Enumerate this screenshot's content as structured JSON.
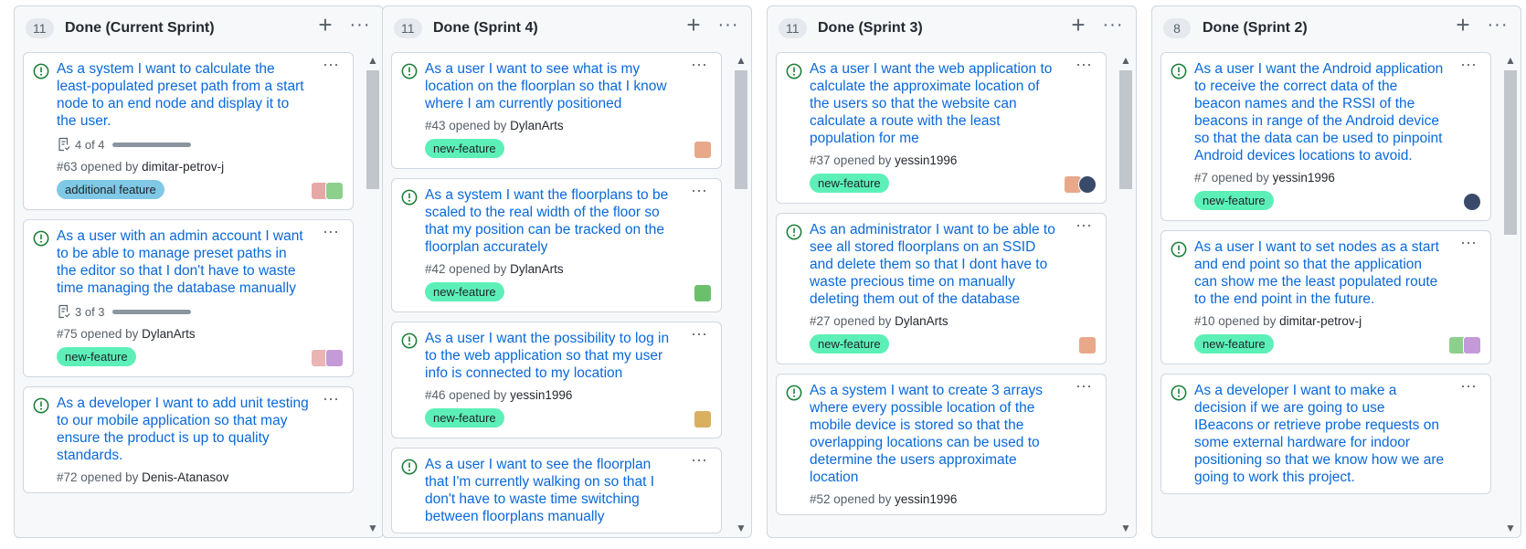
{
  "colors": {
    "link": "#0969da",
    "open_icon": "#1a7f37",
    "label_new_feature": "#5cf0b8",
    "label_additional_feature": "#7fc8e6",
    "label_yellow": "#fbe7a0"
  },
  "columns": [
    {
      "count": "11",
      "title": "Done (Current Sprint)",
      "cards": [
        {
          "title": "As a system I want to calculate the least-populated preset path from a start node to an end node and display it to the user.",
          "tasks": "4 of 4",
          "number": "#63",
          "opened_by": "opened by",
          "user": "dimitar-petrov-j",
          "label": "additional feature",
          "label_color": "#7fc8e6",
          "avatars": [
            {
              "icon": "identicon-green",
              "color": "#8cd08c"
            },
            {
              "icon": "identicon-pink",
              "color": "#e7a7a7"
            }
          ]
        },
        {
          "title": "As a user with an admin account I want to be able to manage preset paths in the editor so that I don't have to waste time managing the database manually",
          "tasks": "3 of 3",
          "number": "#75",
          "opened_by": "opened by",
          "user": "DylanArts",
          "label": "new-feature",
          "label_color": "#5cf0b8",
          "avatars": [
            {
              "icon": "identicon-purple",
              "color": "#c49ad8"
            },
            {
              "icon": "identicon-pink",
              "color": "#e9b5b5"
            }
          ]
        },
        {
          "title": "As a developer I want to add unit testing to our mobile application so that may ensure the product is up to quality standards.",
          "number": "#72",
          "opened_by": "opened by",
          "user": "Denis-Atanasov",
          "label": "",
          "label_color": "#fbe7a0",
          "avatars": []
        }
      ]
    },
    {
      "count": "11",
      "title": "Done (Sprint 4)",
      "cards": [
        {
          "title": "As a user I want to see what is my location on the floorplan so that I know where I am currently positioned",
          "number": "#43",
          "opened_by": "opened by",
          "user": "DylanArts",
          "label": "new-feature",
          "label_color": "#5cf0b8",
          "avatars": [
            {
              "icon": "identicon-orange",
              "color": "#e8a88a"
            }
          ]
        },
        {
          "title": "As a system I want the floorplans to be scaled to the real width of the floor so that my position can be tracked on the floorplan accurately",
          "number": "#42",
          "opened_by": "opened by",
          "user": "DylanArts",
          "label": "new-feature",
          "label_color": "#5cf0b8",
          "avatars": [
            {
              "icon": "identicon-green",
              "color": "#6cc06c"
            }
          ]
        },
        {
          "title": "As a user I want the possibility to log in to the web application so that my user info is connected to my location",
          "number": "#46",
          "opened_by": "opened by",
          "user": "yessin1996",
          "label": "new-feature",
          "label_color": "#5cf0b8",
          "avatars": [
            {
              "icon": "identicon-gold",
              "color": "#d8b060"
            }
          ]
        },
        {
          "title": "As a user I want to see the floorplan that I'm currently walking on so that I don't have to waste time switching between floorplans manually",
          "number": "",
          "opened_by": "",
          "user": "",
          "label": "",
          "label_color": "#5cf0b8",
          "avatars": []
        }
      ]
    },
    {
      "count": "11",
      "title": "Done (Sprint 3)",
      "cards": [
        {
          "title": "As a user I want the web application to calculate the approximate location of the users so that the website can calculate a route with the least population for me",
          "number": "#37",
          "opened_by": "opened by",
          "user": "yessin1996",
          "label": "new-feature",
          "label_color": "#5cf0b8",
          "avatars": [
            {
              "icon": "photo-avatar",
              "color": "#3a4a6a"
            },
            {
              "icon": "identicon-orange",
              "color": "#e8a88a"
            }
          ]
        },
        {
          "title": "As an administrator I want to be able to see all stored floorplans on an SSID and delete them so that I dont have to waste precious time on manually deleting them out of the database",
          "number": "#27",
          "opened_by": "opened by",
          "user": "DylanArts",
          "label": "new-feature",
          "label_color": "#5cf0b8",
          "avatars": [
            {
              "icon": "identicon-orange",
              "color": "#e8a88a"
            }
          ]
        },
        {
          "title": "As a system I want to create 3 arrays where every possible location of the mobile device is stored so that the overlapping locations can be used to determine the users approximate location",
          "number": "#52",
          "opened_by": "opened by",
          "user": "yessin1996",
          "label": "",
          "label_color": "#5cf0b8",
          "avatars": []
        }
      ]
    },
    {
      "count": "8",
      "title": "Done (Sprint 2)",
      "cards": [
        {
          "title": "As a user I want the Android application to receive the correct data of the beacon names and the RSSI of the beacons in range of the Android device so that the data can be used to pinpoint Android devices locations to avoid.",
          "number": "#7",
          "opened_by": "opened by",
          "user": "yessin1996",
          "label": "new-feature",
          "label_color": "#5cf0b8",
          "avatars": [
            {
              "icon": "photo-avatar",
              "color": "#3a4a6a"
            }
          ]
        },
        {
          "title": "As a user I want to set nodes as a start and end point so that the application can show me the least populated route to the end point in the future.",
          "number": "#10",
          "opened_by": "opened by",
          "user": "dimitar-petrov-j",
          "label": "new-feature",
          "label_color": "#5cf0b8",
          "avatars": [
            {
              "icon": "identicon-purple",
              "color": "#c49ad8"
            },
            {
              "icon": "identicon-green",
              "color": "#8cd08c"
            }
          ]
        },
        {
          "title": "As a developer I want to make a decision if we are going to use IBeacons or retrieve probe requests on some external hardware for indoor positioning so that we know how we are going to work this project.",
          "number": "",
          "opened_by": "",
          "user": "",
          "label": "",
          "label_color": "#5cf0b8",
          "avatars": []
        }
      ]
    }
  ],
  "icons": {
    "add": "+",
    "menu": "···",
    "scroll_up": "▲",
    "scroll_down": "▼"
  },
  "scroll": [
    {
      "thumb_fraction": 0.13
    },
    {
      "thumb_fraction": 0.13
    },
    {
      "thumb_fraction": 0.13
    },
    {
      "thumb_fraction": 0.18
    }
  ]
}
